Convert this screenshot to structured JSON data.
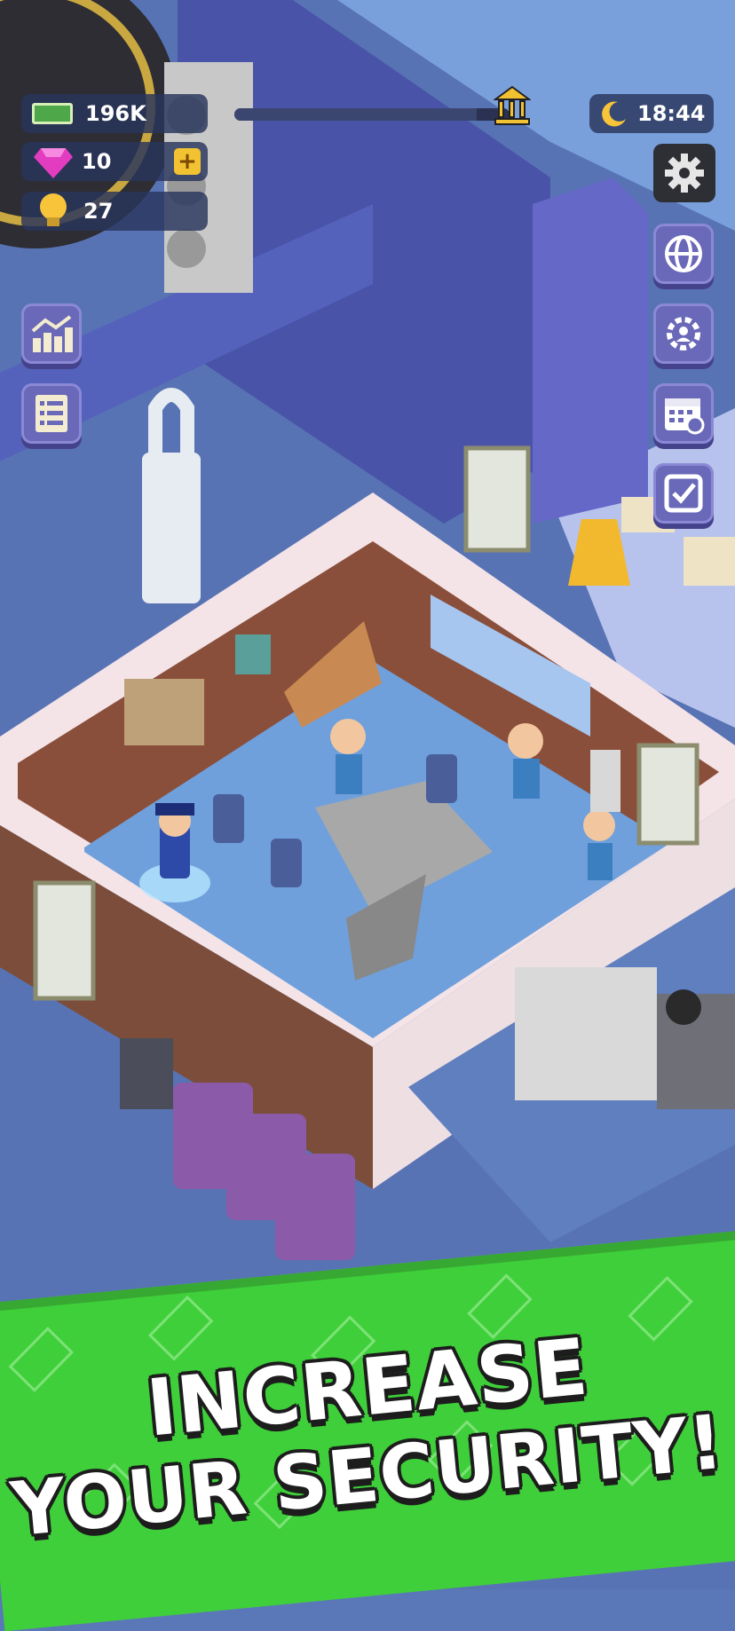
{
  "hud": {
    "cash": "196K",
    "gems": "10",
    "ideas": "27",
    "clock": "18:44",
    "progress_fraction": 0.88
  },
  "side_menu_left": [
    {
      "icon": "stats-chart-icon"
    },
    {
      "icon": "task-list-icon"
    }
  ],
  "side_menu_right": [
    {
      "icon": "settings-gear-icon"
    },
    {
      "icon": "globe-icon"
    },
    {
      "icon": "manager-settings-icon"
    },
    {
      "icon": "calendar-icon"
    },
    {
      "icon": "checklist-icon"
    }
  ],
  "banner": {
    "line1": "INCREASE",
    "line2": "YOUR SECURITY!"
  },
  "colors": {
    "banner_green": "#3fcf3a",
    "button_purple": "#6a68b8",
    "hud_bg": "#28345c"
  }
}
